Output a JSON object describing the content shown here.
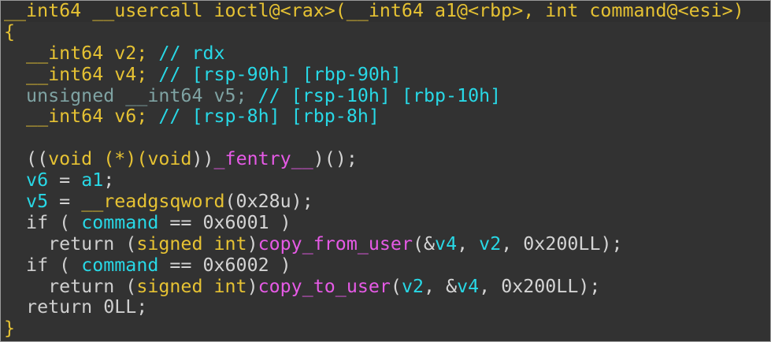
{
  "code": {
    "lines": [
      [
        {
          "t": "__int64 __usercall ioctl@<rax>(__int64 a1@<rbp>, int command@<esi>)",
          "c": "type"
        }
      ],
      [
        {
          "t": "{",
          "c": "type"
        }
      ],
      [
        {
          "t": "  __int64 v2; ",
          "c": "type"
        },
        {
          "t": "// rdx",
          "c": "com"
        }
      ],
      [
        {
          "t": "  __int64 v4; ",
          "c": "type"
        },
        {
          "t": "// [rsp-90h] [rbp-90h]",
          "c": "com"
        }
      ],
      [
        {
          "t": "  unsigned __int64 v5; ",
          "c": "type2"
        },
        {
          "t": "// [rsp-10h] [rbp-10h]",
          "c": "com"
        }
      ],
      [
        {
          "t": "  __int64 v6; ",
          "c": "type"
        },
        {
          "t": "// [rsp-8h] [rbp-8h]",
          "c": "com"
        }
      ],
      [
        {
          "t": "",
          "c": "plain"
        }
      ],
      [
        {
          "t": "  ((",
          "c": "plain"
        },
        {
          "t": "void",
          "c": "type"
        },
        {
          "t": " (*)(",
          "c": "type"
        },
        {
          "t": "void",
          "c": "type"
        },
        {
          "t": "))",
          "c": "plain"
        },
        {
          "t": "_fentry__",
          "c": "func"
        },
        {
          "t": ")();",
          "c": "plain"
        }
      ],
      [
        {
          "t": "  v6",
          "c": "var"
        },
        {
          "t": " = ",
          "c": "plain"
        },
        {
          "t": "a1",
          "c": "var"
        },
        {
          "t": ";",
          "c": "plain"
        }
      ],
      [
        {
          "t": "  v5",
          "c": "var"
        },
        {
          "t": " = ",
          "c": "plain"
        },
        {
          "t": "__readgsqword",
          "c": "type"
        },
        {
          "t": "(0x28u);",
          "c": "plain"
        }
      ],
      [
        {
          "t": "  if ( ",
          "c": "kw"
        },
        {
          "t": "command",
          "c": "var"
        },
        {
          "t": " == 0x6001 )",
          "c": "plain"
        }
      ],
      [
        {
          "t": "    return (",
          "c": "kw"
        },
        {
          "t": "signed int",
          "c": "type"
        },
        {
          "t": ")",
          "c": "plain"
        },
        {
          "t": "copy_from_user",
          "c": "func"
        },
        {
          "t": "(&",
          "c": "plain"
        },
        {
          "t": "v4",
          "c": "var"
        },
        {
          "t": ", ",
          "c": "plain"
        },
        {
          "t": "v2",
          "c": "var"
        },
        {
          "t": ", 0x200LL);",
          "c": "plain"
        }
      ],
      [
        {
          "t": "  if ( ",
          "c": "kw"
        },
        {
          "t": "command",
          "c": "var"
        },
        {
          "t": " == 0x6002 )",
          "c": "plain"
        }
      ],
      [
        {
          "t": "    return (",
          "c": "kw"
        },
        {
          "t": "signed int",
          "c": "type"
        },
        {
          "t": ")",
          "c": "plain"
        },
        {
          "t": "copy_to_user",
          "c": "func"
        },
        {
          "t": "(",
          "c": "plain"
        },
        {
          "t": "v2",
          "c": "var"
        },
        {
          "t": ", &",
          "c": "plain"
        },
        {
          "t": "v4",
          "c": "var"
        },
        {
          "t": ", 0x200LL);",
          "c": "plain"
        }
      ],
      [
        {
          "t": "  return 0LL;",
          "c": "kw"
        }
      ],
      [
        {
          "t": "}",
          "c": "type"
        }
      ]
    ]
  }
}
